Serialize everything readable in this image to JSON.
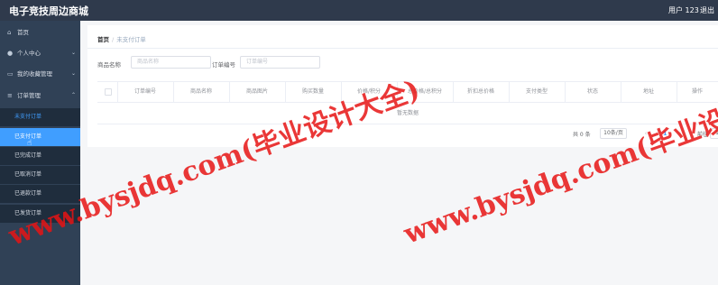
{
  "header": {
    "title": "电子竞技周边商城",
    "user": "用户 123",
    "logout": "退出"
  },
  "sidebar": {
    "items": [
      {
        "label": "首页",
        "icon": "home-icon"
      },
      {
        "label": "个人中心",
        "icon": "user-icon"
      },
      {
        "label": "我的收藏管理",
        "icon": "folder-icon"
      },
      {
        "label": "订单管理",
        "icon": "order-icon"
      }
    ],
    "submenu": [
      {
        "label": "未支付订单"
      },
      {
        "label": "已支付订单"
      },
      {
        "label": "已完成订单"
      },
      {
        "label": "已取消订单"
      },
      {
        "label": "已退款订单"
      },
      {
        "label": "已发货订单"
      }
    ]
  },
  "breadcrumb": {
    "home": "首页",
    "separator": "/",
    "current": "未支付订单"
  },
  "search": {
    "name_label": "商品名称",
    "name_placeholder": "商品名称",
    "order_label": "订单编号",
    "order_placeholder": "订单编号"
  },
  "table": {
    "columns": [
      "订单编号",
      "商品名称",
      "商品图片",
      "购买数量",
      "价格/积分",
      "总价格/总积分",
      "折扣总价格",
      "支付类型",
      "状态",
      "地址",
      "操作"
    ],
    "empty": "暂无数据"
  },
  "pagination": {
    "total": "共 0 条",
    "page_size": "10条/页",
    "current_page": "1",
    "goto_label": "前往",
    "goto_value": "1"
  },
  "watermark": {
    "text": "www.bysjdq.com(毕业设计大全)"
  },
  "colors": {
    "header_bg": "#2f3a4c",
    "sidebar_bg": "#304156",
    "accent": "#409eff",
    "watermark": "#e61414"
  }
}
